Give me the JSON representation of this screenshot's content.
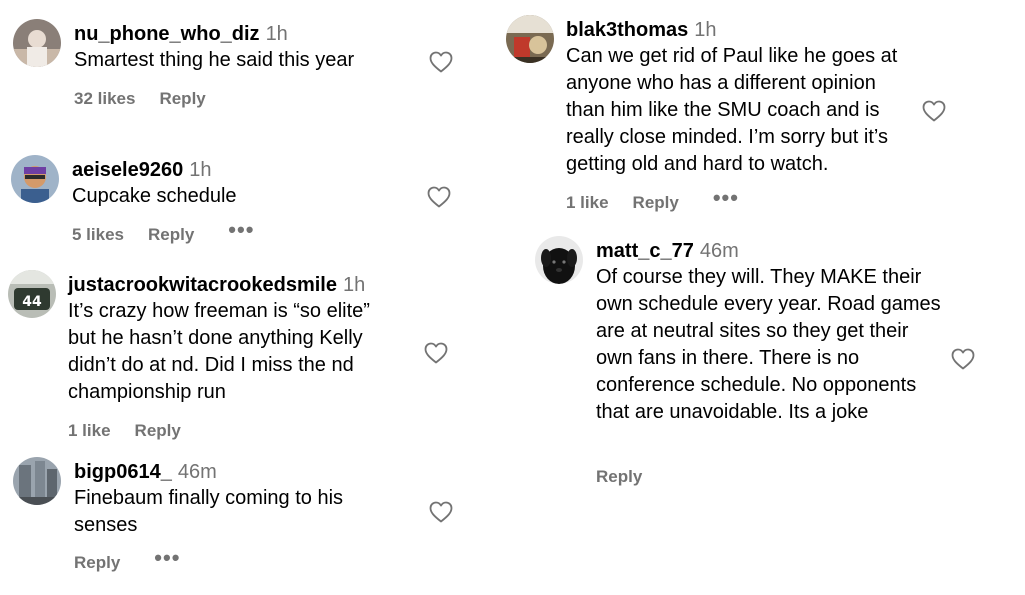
{
  "comments": [
    {
      "username": "nu_phone_who_diz",
      "time": "1h",
      "text": "Smartest thing he said this year",
      "likes": "32 likes",
      "reply": "Reply"
    },
    {
      "username": "aeisele9260",
      "time": "1h",
      "text": "Cupcake schedule",
      "likes": "5 likes",
      "reply": "Reply",
      "more": "•••"
    },
    {
      "username": "justacrookwitacrookedsmile",
      "time": "1h",
      "text": "It’s crazy how freeman is “so elite” but he hasn’t done anything Kelly didn’t do at nd. Did I miss the nd championship run",
      "likes": "1 like",
      "reply": "Reply"
    },
    {
      "username": "bigp0614_",
      "time": "46m",
      "text": "Finebaum finally coming to his senses",
      "reply": "Reply",
      "more": "•••"
    },
    {
      "username": "blak3thomas",
      "time": "1h",
      "text": "Can we get rid of Paul like he goes at anyone who has a different opinion than him like the SMU coach and is really close minded. I’m sorry but it’s getting old and hard to watch.",
      "likes": "1 like",
      "reply": "Reply",
      "more": "•••"
    },
    {
      "username": "matt_c_77",
      "time": "46m",
      "text": "Of course they will. They MAKE their own schedule every year. Road games are at neutral sites so they get their own fans in there. There is no conference schedule. No opponents that are unavoidable. Its a joke",
      "reply": "Reply"
    }
  ],
  "icons": {
    "like": "heart-outline-icon",
    "more": "more-options-icon"
  },
  "colors": {
    "secondary_text": "#737373",
    "primary_text": "#000000",
    "heart_stroke": "#737373"
  }
}
